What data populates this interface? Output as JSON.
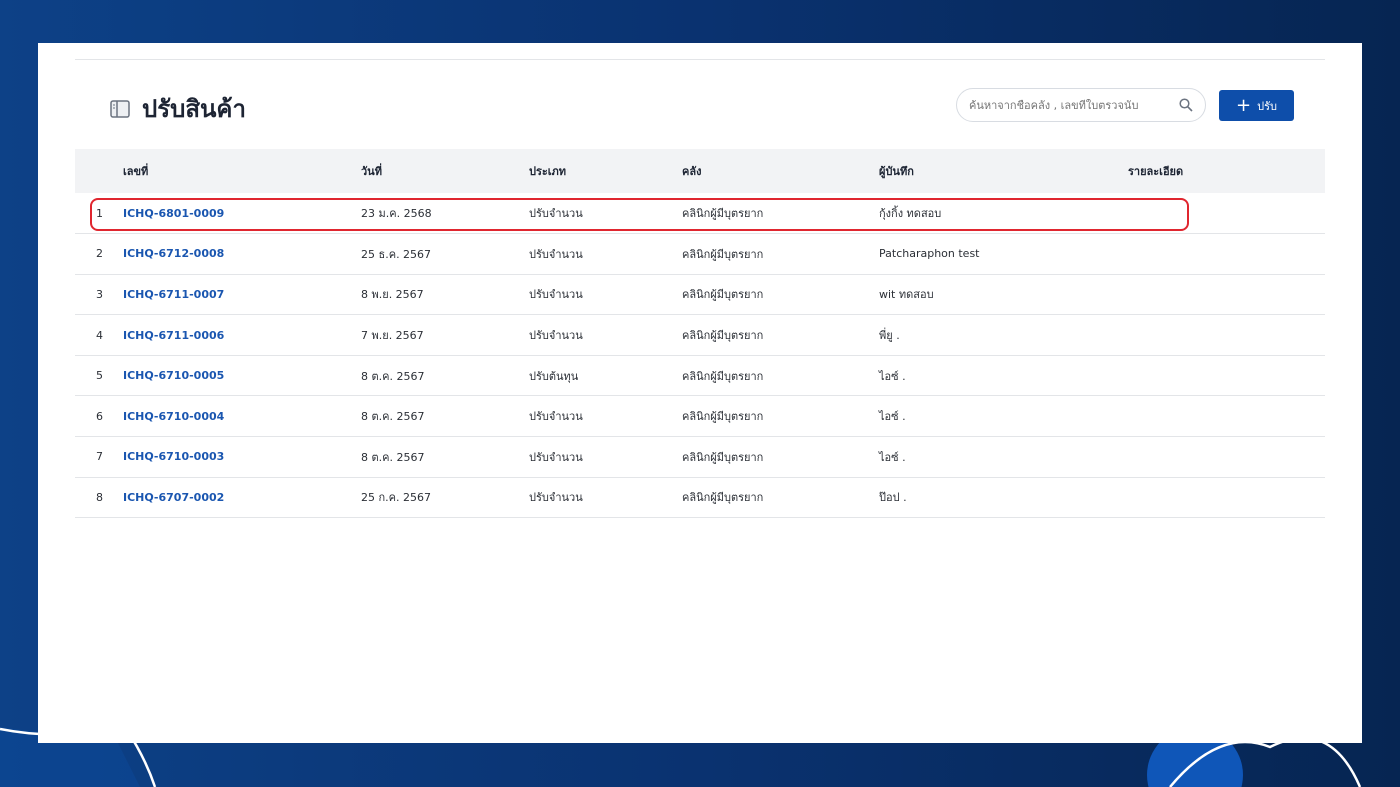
{
  "page": {
    "title": "ปรับสินค้า",
    "search_placeholder": "ค้นหาจากชื่อคลัง , เลขที่ใบตรวจนับ",
    "add_button": "ปรับ"
  },
  "table": {
    "headers": [
      "เลขที่",
      "วันที่",
      "ประเภท",
      "คลัง",
      "ผู้บันทึก",
      "รายละเอียด"
    ],
    "rows": [
      {
        "n": "1",
        "id": "ICHQ-6801-0009",
        "date": "23 ม.ค. 2568",
        "type": "ปรับจำนวน",
        "wh": "คลินิกผู้มีบุตรยาก",
        "by": "กุ้งกิ้ง ทดสอบ",
        "detail": ""
      },
      {
        "n": "2",
        "id": "ICHQ-6712-0008",
        "date": "25 ธ.ค. 2567",
        "type": "ปรับจำนวน",
        "wh": "คลินิกผู้มีบุตรยาก",
        "by": "Patcharaphon test",
        "detail": ""
      },
      {
        "n": "3",
        "id": "ICHQ-6711-0007",
        "date": "8 พ.ย. 2567",
        "type": "ปรับจำนวน",
        "wh": "คลินิกผู้มีบุตรยาก",
        "by": "wit ทดสอบ",
        "detail": ""
      },
      {
        "n": "4",
        "id": "ICHQ-6711-0006",
        "date": "7 พ.ย. 2567",
        "type": "ปรับจำนวน",
        "wh": "คลินิกผู้มีบุตรยาก",
        "by": "พี่ยู .",
        "detail": ""
      },
      {
        "n": "5",
        "id": "ICHQ-6710-0005",
        "date": "8 ต.ค. 2567",
        "type": "ปรับต้นทุน",
        "wh": "คลินิกผู้มีบุตรยาก",
        "by": "ไอซ์ .",
        "detail": ""
      },
      {
        "n": "6",
        "id": "ICHQ-6710-0004",
        "date": "8 ต.ค. 2567",
        "type": "ปรับจำนวน",
        "wh": "คลินิกผู้มีบุตรยาก",
        "by": "ไอซ์ .",
        "detail": ""
      },
      {
        "n": "7",
        "id": "ICHQ-6710-0003",
        "date": "8 ต.ค. 2567",
        "type": "ปรับจำนวน",
        "wh": "คลินิกผู้มีบุตรยาก",
        "by": "ไอซ์ .",
        "detail": ""
      },
      {
        "n": "8",
        "id": "ICHQ-6707-0002",
        "date": "25 ก.ค. 2567",
        "type": "ปรับจำนวน",
        "wh": "คลินิกผู้มีบุตรยาก",
        "by": "ป๊อป .",
        "detail": ""
      }
    ]
  },
  "colors": {
    "accent": "#0e4eaa",
    "link": "#1a56b0",
    "highlight": "#e0262f"
  }
}
